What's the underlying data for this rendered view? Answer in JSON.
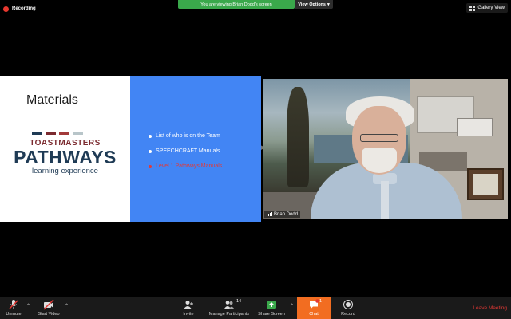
{
  "recording": {
    "label": "Recording",
    "color": "#e8382f"
  },
  "share_banner": {
    "text": "You are viewing Brian Dodd's screen",
    "color": "#3aa84b"
  },
  "view_options": {
    "label": "View Options"
  },
  "gallery_view": {
    "label": "Gallery View"
  },
  "slide": {
    "title": "Materials",
    "logo": {
      "top": "TOASTMASTERS",
      "main": "PATHWAYS",
      "sub": "learning experience",
      "square_colors": [
        "#1f3b55",
        "#7b2a2f",
        "#a23a3a",
        "#b8c5c9"
      ]
    },
    "bullets": [
      {
        "text": "List of who is on the Team",
        "highlight": false
      },
      {
        "text": "SPEECHCRAFT Manuals",
        "highlight": false
      },
      {
        "text": "Level 1 Pathways Manuals",
        "highlight": true
      }
    ],
    "accent": "#4285f4"
  },
  "video": {
    "participant_name": "Brian Dodd"
  },
  "toolbar": {
    "unmute": "Unmute",
    "start_video": "Start Video",
    "invite": "Invite",
    "manage_participants": "Manage Participants",
    "participant_count": "14",
    "share_screen": "Share Screen",
    "chat": "Chat",
    "chat_badge": "1",
    "record": "Record",
    "leave": "Leave Meeting",
    "share_color": "#3aa84b",
    "chat_color": "#f26d21",
    "leave_color": "#e53935"
  }
}
